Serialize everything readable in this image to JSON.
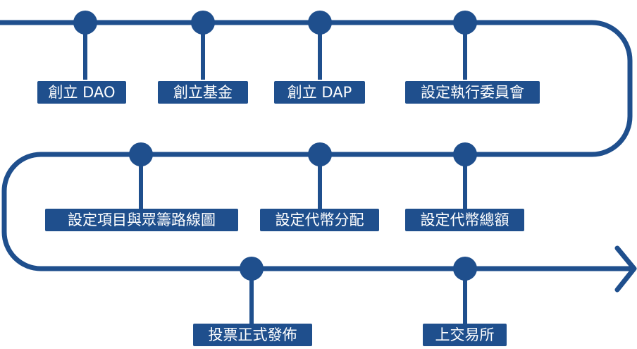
{
  "colors": {
    "path": "#1f4f8d",
    "label_bg": "#1f4f8d",
    "label_text": "#ffffff"
  },
  "steps": [
    {
      "label": "創立 DAO"
    },
    {
      "label": "創立基金"
    },
    {
      "label": "創立 DAP"
    },
    {
      "label": "設定執行委員會"
    },
    {
      "label": "設定項目與眾籌路線圖"
    },
    {
      "label": "設定代幣分配"
    },
    {
      "label": "設定代幣總額"
    },
    {
      "label": "投票正式發佈"
    },
    {
      "label": "上交易所"
    }
  ]
}
